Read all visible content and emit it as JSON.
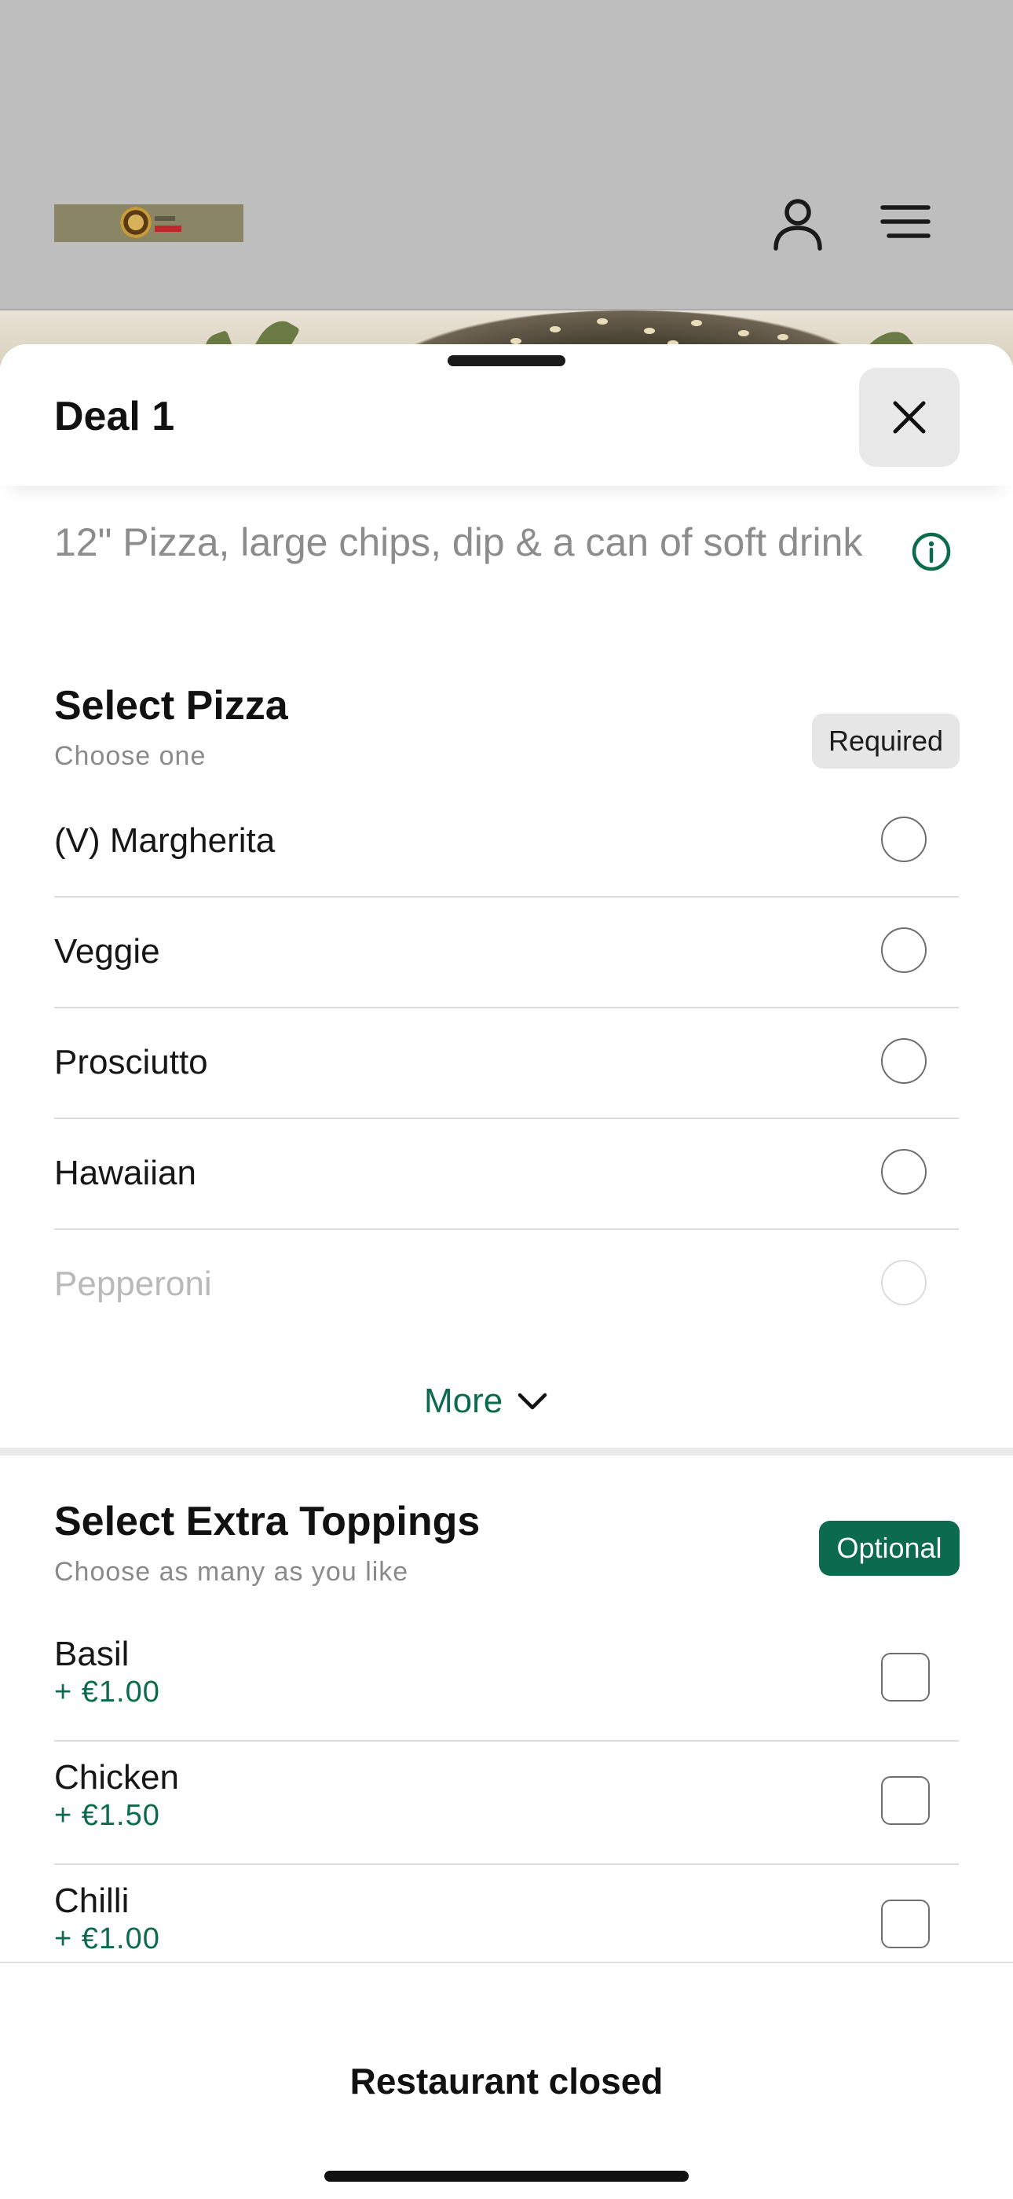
{
  "background": {
    "logo_alt": "restaurant-logo",
    "account_icon": "person-icon",
    "menu_icon": "hamburger-menu-icon"
  },
  "sheet": {
    "title": "Deal 1",
    "close_icon": "close-icon",
    "description": "12\" Pizza, large chips, dip & a can of soft drink",
    "info_icon": "info-icon"
  },
  "pizza_section": {
    "title": "Select Pizza",
    "subtitle": "Choose one",
    "badge": "Required",
    "options": [
      {
        "label": "(V) Margherita"
      },
      {
        "label": "Veggie"
      },
      {
        "label": "Prosciutto"
      },
      {
        "label": "Hawaiian"
      },
      {
        "label": "Pepperoni"
      }
    ],
    "more_label": "More",
    "more_icon": "chevron-down-icon"
  },
  "toppings_section": {
    "title": "Select Extra Toppings",
    "subtitle": "Choose as many as you like",
    "badge": "Optional",
    "items": [
      {
        "name": "Basil",
        "price": "+ €1.00"
      },
      {
        "name": "Chicken",
        "price": "+ €1.50"
      },
      {
        "name": "Chilli",
        "price": "+ €1.00"
      }
    ]
  },
  "footer": {
    "status": "Restaurant closed"
  },
  "colors": {
    "accent": "#0c6a4d",
    "muted_text": "#8a8a8a",
    "overlay_bg": "#bdbdbd"
  }
}
